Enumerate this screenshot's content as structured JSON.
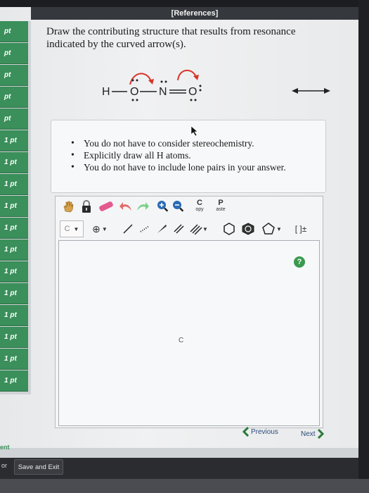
{
  "header": {
    "references_label": "[References]"
  },
  "sidebar": {
    "items": [
      {
        "label": "pt"
      },
      {
        "label": "pt"
      },
      {
        "label": "pt"
      },
      {
        "label": "pt"
      },
      {
        "label": "pt"
      },
      {
        "label": "1 pt"
      },
      {
        "label": "1 pt"
      },
      {
        "label": "1 pt"
      },
      {
        "label": "1 pt"
      },
      {
        "label": "1 pt"
      },
      {
        "label": "1 pt"
      },
      {
        "label": "1 pt"
      },
      {
        "label": "1 pt"
      },
      {
        "label": "1 pt"
      },
      {
        "label": "1 pt"
      },
      {
        "label": "1 pt"
      },
      {
        "label": "1 pt"
      }
    ]
  },
  "question": {
    "text": "Draw the contributing structure that results from resonance indicated by the curved arrow(s).",
    "molecule": {
      "h": "H",
      "o1": "O",
      "n": "N",
      "o2": "O"
    }
  },
  "hints": {
    "items": [
      "You do not have to consider stereochemistry.",
      "Explicitly draw all H atoms.",
      "You do not have to include lone pairs in your answer."
    ]
  },
  "toolbar": {
    "copy_top": "C",
    "copy_bottom": "opy",
    "paste_top": "P",
    "paste_bottom": "aste",
    "element_label": "C",
    "bracket_label": "[ ]±"
  },
  "canvas": {
    "atom_label": "C"
  },
  "help": {
    "label": "?"
  },
  "nav": {
    "previous": "Previous",
    "next": "Next"
  },
  "footer": {
    "ent_label": "ent",
    "or_label": "or",
    "save_exit": "Save and Exit"
  },
  "colors": {
    "accent_green": "#3a8f5a",
    "arrow_red": "#d8342a"
  }
}
